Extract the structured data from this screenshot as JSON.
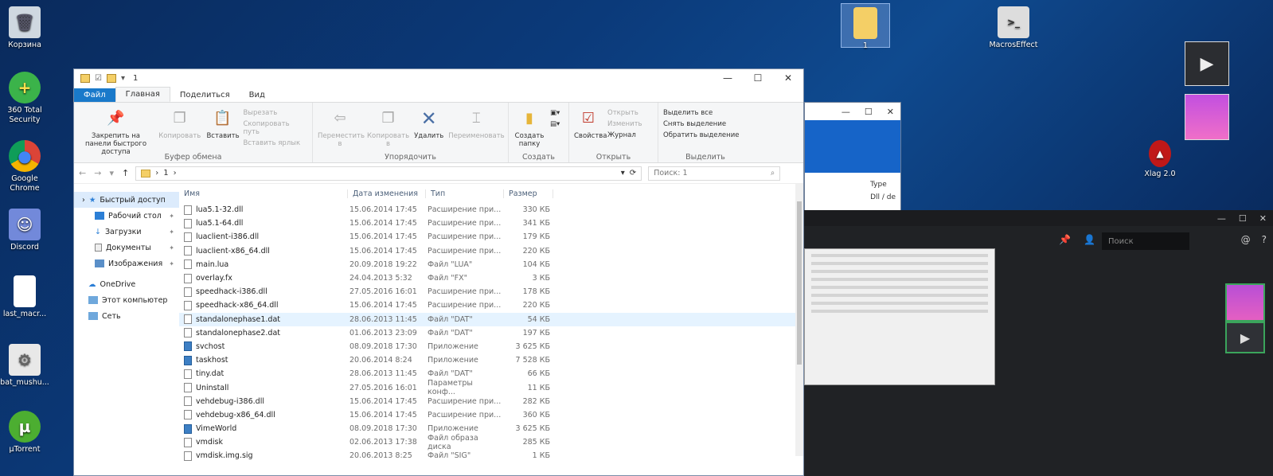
{
  "desktop": {
    "icons": [
      {
        "label": "Корзина"
      },
      {
        "label": "360 Total Security"
      },
      {
        "label": "Google Chrome"
      },
      {
        "label": "Discord"
      },
      {
        "label": "last_macr..."
      },
      {
        "label": "bat_mushu..."
      },
      {
        "label": "µTorrent"
      },
      {
        "label": "1"
      },
      {
        "label": "MacrosEffect"
      },
      {
        "label": "Xlag 2.0"
      }
    ]
  },
  "explorer": {
    "window_title": "1",
    "tabs": {
      "file": "Файл",
      "home": "Главная",
      "share": "Поделиться",
      "view": "Вид"
    },
    "ribbon": {
      "pin_quick": "Закрепить на панели быстрого доступа",
      "copy": "Копировать",
      "paste": "Вставить",
      "cut": "Вырезать",
      "copy_path": "Скопировать путь",
      "paste_shortcut": "Вставить ярлык",
      "clipboard_group": "Буфер обмена",
      "move_to": "Переместить в",
      "copy_to": "Копировать в",
      "delete": "Удалить",
      "rename": "Переименовать",
      "organize_group": "Упорядочить",
      "new_folder": "Создать папку",
      "create_group": "Создать",
      "properties": "Свойства",
      "open": "Открыть",
      "edit": "Изменить",
      "history": "Журнал",
      "open_group": "Открыть",
      "select_all": "Выделить все",
      "select_none": "Снять выделение",
      "invert_selection": "Обратить выделение",
      "select_group": "Выделить"
    },
    "address": {
      "path": "1",
      "search_placeholder": "Поиск: 1"
    },
    "nav": {
      "quick_access": "Быстрый доступ",
      "desktop": "Рабочий стол",
      "downloads": "Загрузки",
      "documents": "Документы",
      "pictures": "Изображения",
      "onedrive": "OneDrive",
      "this_pc": "Этот компьютер",
      "network": "Сеть"
    },
    "columns": {
      "name": "Имя",
      "date": "Дата изменения",
      "type": "Тип",
      "size": "Размер"
    },
    "files": [
      {
        "name": "lua5.1-32.dll",
        "date": "15.06.2014 17:45",
        "type": "Расширение при...",
        "size": "330 КБ"
      },
      {
        "name": "lua5.1-64.dll",
        "date": "15.06.2014 17:45",
        "type": "Расширение при...",
        "size": "341 КБ"
      },
      {
        "name": "luaclient-i386.dll",
        "date": "15.06.2014 17:45",
        "type": "Расширение при...",
        "size": "179 КБ"
      },
      {
        "name": "luaclient-x86_64.dll",
        "date": "15.06.2014 17:45",
        "type": "Расширение при...",
        "size": "220 КБ"
      },
      {
        "name": "main.lua",
        "date": "20.09.2018 19:22",
        "type": "Файл \"LUA\"",
        "size": "104 КБ"
      },
      {
        "name": "overlay.fx",
        "date": "24.04.2013 5:32",
        "type": "Файл \"FX\"",
        "size": "3 КБ"
      },
      {
        "name": "speedhack-i386.dll",
        "date": "27.05.2016 16:01",
        "type": "Расширение при...",
        "size": "178 КБ"
      },
      {
        "name": "speedhack-x86_64.dll",
        "date": "15.06.2014 17:45",
        "type": "Расширение при...",
        "size": "220 КБ"
      },
      {
        "name": "standalonephase1.dat",
        "date": "28.06.2013 11:45",
        "type": "Файл \"DAT\"",
        "size": "54 КБ"
      },
      {
        "name": "standalonephase2.dat",
        "date": "01.06.2013 23:09",
        "type": "Файл \"DAT\"",
        "size": "197 КБ"
      },
      {
        "name": "svchost",
        "date": "08.09.2018 17:30",
        "type": "Приложение",
        "size": "3 625 КБ"
      },
      {
        "name": "taskhost",
        "date": "20.06.2014 8:24",
        "type": "Приложение",
        "size": "7 528 КБ"
      },
      {
        "name": "tiny.dat",
        "date": "28.06.2013 11:45",
        "type": "Файл \"DAT\"",
        "size": "66 КБ"
      },
      {
        "name": "Uninstall",
        "date": "27.05.2016 16:01",
        "type": "Параметры конф...",
        "size": "11 КБ"
      },
      {
        "name": "vehdebug-i386.dll",
        "date": "15.06.2014 17:45",
        "type": "Расширение при...",
        "size": "282 КБ"
      },
      {
        "name": "vehdebug-x86_64.dll",
        "date": "15.06.2014 17:45",
        "type": "Расширение при...",
        "size": "360 КБ"
      },
      {
        "name": "VimeWorld",
        "date": "08.09.2018 17:30",
        "type": "Приложение",
        "size": "3 625 КБ"
      },
      {
        "name": "vmdisk",
        "date": "02.06.2013 17:38",
        "type": "Файл образа диска",
        "size": "285 КБ"
      },
      {
        "name": "vmdisk.img.sig",
        "date": "20.06.2013 8:25",
        "type": "Файл \"SIG\"",
        "size": "1 КБ"
      }
    ]
  },
  "bg_window": {
    "type_header": "Type",
    "row1": "Dll / de"
  },
  "discord": {
    "search_placeholder": "Поиск"
  }
}
